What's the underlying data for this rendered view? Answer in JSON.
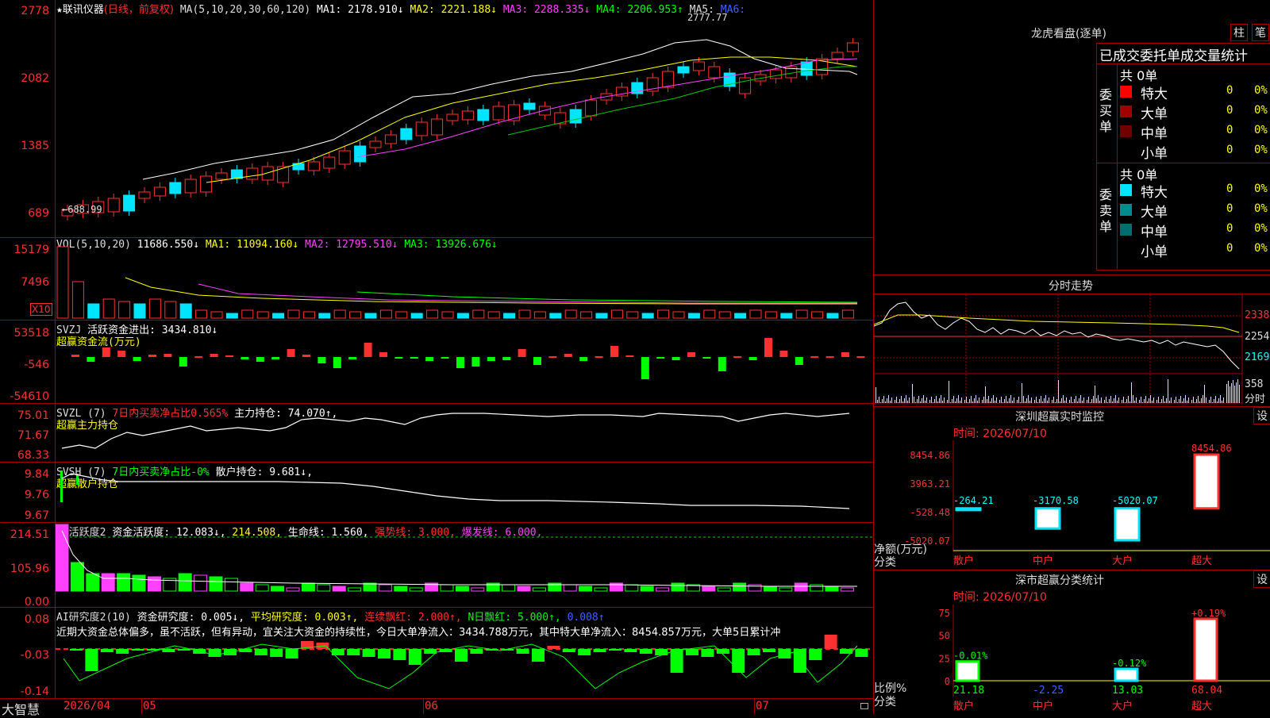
{
  "header": {
    "star": "★",
    "title": "联讯仪器",
    "title_mode": "(日线，前复权)",
    "ma_params": "MA(5,10,20,30,60,120)",
    "ma1": "MA1: 2178.910↓",
    "ma2": "MA2: 2221.188↓",
    "ma3": "MA3: 2288.335↓",
    "ma4": "MA4: 2206.953↑",
    "ma5": "MA5:",
    "ma6": "MA6:"
  },
  "price_axis": [
    "2778",
    "2082",
    "1385",
    "689"
  ],
  "price_high_label": "2777.77",
  "price_low_label": "←688.99",
  "volume": {
    "header_name": "VOL(5,10,20)",
    "value": "11686.550↓",
    "ma1": "MA1: 11094.160↓",
    "ma2": "MA2: 12795.510↓",
    "ma3": "MA3: 13926.676↓",
    "axis": [
      "15179",
      "7496"
    ],
    "unit": "X10"
  },
  "svzj": {
    "header_name": "SVZJ",
    "label": "活跃资金进出: 3434.810↓",
    "subtitle": "超赢资金流(万元)",
    "axis": [
      "53518",
      "-546",
      "-54610"
    ]
  },
  "svzl": {
    "header_name": "SVZL (7)",
    "ratio": "7日内买卖净占比0.565%",
    "main": "主力持仓: 74.070↑,",
    "subtitle": "超赢主力持仓",
    "axis": [
      "75.01",
      "71.67",
      "68.33"
    ]
  },
  "svsh": {
    "header_name": "SVSH (7)",
    "ratio": "7日内买卖净占比-0%",
    "main": "散户持仓: 9.681↓,",
    "subtitle": "超赢散户持仓",
    "axis": [
      "9.84",
      "9.76",
      "9.67"
    ]
  },
  "ai_active": {
    "header_name": "AI活跃度2",
    "active": "资金活跃度: 12.083↓,",
    "v2": "214.508,",
    "life": "生命线: 1.560,",
    "strong": "强势线: 3.000,",
    "burst": "爆发线: 6.000,",
    "axis": [
      "214.51",
      "105.96",
      "0.00"
    ]
  },
  "ai_research": {
    "header_name": "AI研究度2(10)",
    "research": "资金研究度: 0.005↓,",
    "avg": "平均研究度: 0.003↑,",
    "red": "连续飘红: 2.000↑,",
    "nred": "N日飘红: 5.000↑,",
    "last": "0.008↑",
    "axis": [
      "0.08",
      "-0.03",
      "-0.14"
    ],
    "comment": "近期大资金总体偏多，虽不活跃，但有异动，宜关注大资金的持续性，今日大单净流入：3434.788万元，其中特大单净流入：8454.857万元，大单5日累计冲"
  },
  "bottom": {
    "brand": "大智慧",
    "dates": [
      "2026/04",
      "05",
      "06",
      "07"
    ]
  },
  "right": {
    "dragon_title": "龙虎看盘(逐单)",
    "btn_zhu": "柱",
    "btn_bi": "笔",
    "stats_title": "已成交委托单成交量统计",
    "buy": {
      "side_label": "委买单",
      "total": "共 0单",
      "rows": [
        {
          "name": "特大",
          "count": "0",
          "pct": "0%",
          "color": "#ff0000"
        },
        {
          "name": "大单",
          "count": "0",
          "pct": "0%",
          "color": "#a00000"
        },
        {
          "name": "中单",
          "count": "0",
          "pct": "0%",
          "color": "#700000"
        },
        {
          "name": "小单",
          "count": "0",
          "pct": "0%",
          "color": "#000000"
        }
      ]
    },
    "sell": {
      "side_label": "委卖单",
      "total": "共 0单",
      "rows": [
        {
          "name": "特大",
          "count": "0",
          "pct": "0%",
          "color": "#00e5ff"
        },
        {
          "name": "大单",
          "count": "0",
          "pct": "0%",
          "color": "#008c8c"
        },
        {
          "name": "中单",
          "count": "0",
          "pct": "0%",
          "color": "#006e6e"
        },
        {
          "name": "小单",
          "count": "0",
          "pct": "0%",
          "color": "#000000"
        }
      ]
    },
    "intraday_title": "分时走势",
    "intraday_axis": [
      "2338",
      "2254",
      "2169"
    ],
    "intraday_vol": "358",
    "intraday_unit": "分时",
    "monitor": {
      "title": "深圳超赢实时监控",
      "btn": "设",
      "time": "时间: 2026/07/10",
      "axis": [
        "8454.86",
        "3963.21",
        "-528.48",
        "-5020.07"
      ],
      "y_label": "净额(万元)",
      "x_label": "分类",
      "categories": [
        "散户",
        "中户",
        "大户",
        "超大"
      ],
      "values": [
        -264.21,
        -3170.58,
        -5020.07,
        8454.86
      ],
      "value_labels": [
        "-264.21",
        "-3170.58",
        "-5020.07",
        "8454.86"
      ]
    },
    "classify": {
      "title": "深市超赢分类统计",
      "btn": "设",
      "time": "时间: 2026/07/10",
      "axis": [
        "75",
        "50",
        "25",
        "0"
      ],
      "y_label": "比例%",
      "x_label": "分类",
      "categories": [
        "散户",
        "中户",
        "大户",
        "超大"
      ],
      "top_labels": [
        "-0.01%",
        "",
        "-0.12%",
        "+0.19%"
      ],
      "values": [
        21.18,
        -2.25,
        13.03,
        68.04
      ],
      "value_labels": [
        "21.18",
        "-2.25",
        "13.03",
        "68.04"
      ]
    }
  },
  "colors": {
    "up": "#ff3030",
    "down": "#00e5ff",
    "frame": "#a00000",
    "ma1": "#ffffff",
    "ma2": "#ffff00",
    "ma3": "#ff40ff",
    "ma4": "#00ff00"
  },
  "chart_data": {
    "type": "candlestick",
    "series": [
      {
        "name": "MA1",
        "value": 2178.91
      },
      {
        "name": "MA2",
        "value": 2221.188
      },
      {
        "name": "MA3",
        "value": 2288.335
      },
      {
        "name": "MA4",
        "value": 2206.953
      }
    ],
    "ylim": [
      689,
      2778
    ],
    "high": 2777.77,
    "low": 688.99
  }
}
